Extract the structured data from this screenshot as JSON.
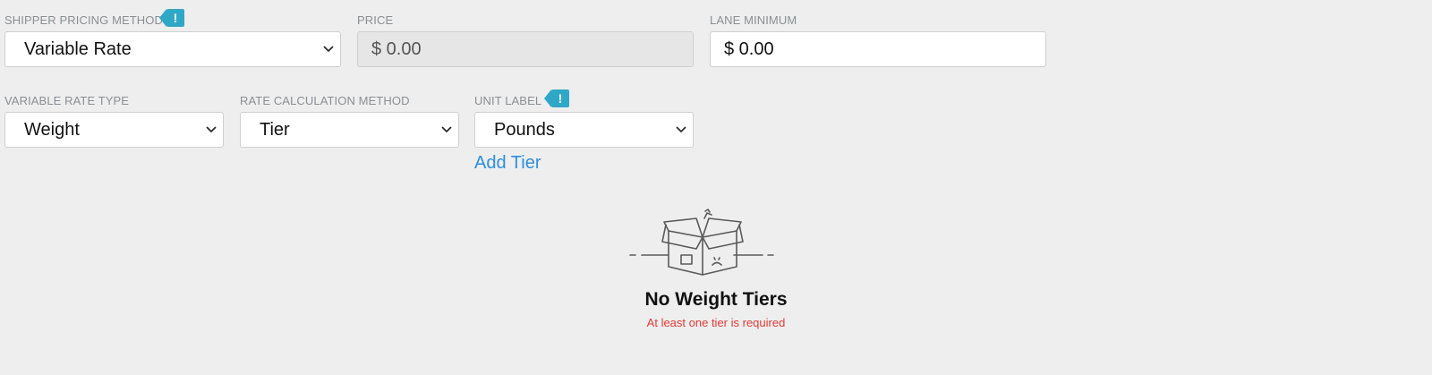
{
  "pricing": {
    "method_label": "SHIPPER PRICING METHOD",
    "method_value": "Variable Rate",
    "price_label": "PRICE",
    "price_value": "$ 0.00",
    "lane_min_label": "LANE MINIMUM",
    "lane_min_value": "$ 0.00",
    "info_badge": "!"
  },
  "rates": {
    "type_label": "VARIABLE RATE TYPE",
    "type_value": "Weight",
    "calc_label": "RATE CALCULATION METHOD",
    "calc_value": "Tier",
    "unit_label": "UNIT LABEL",
    "unit_value": "Pounds",
    "info_badge": "!"
  },
  "tiers": {
    "add_label": "Add Tier",
    "empty_title": "No Weight Tiers",
    "empty_subtitle": "At least one tier is required"
  },
  "colors": {
    "background": "#eeeeee",
    "badge": "#2fa8c7",
    "link": "#2b8fe0",
    "error": "#e53935"
  }
}
